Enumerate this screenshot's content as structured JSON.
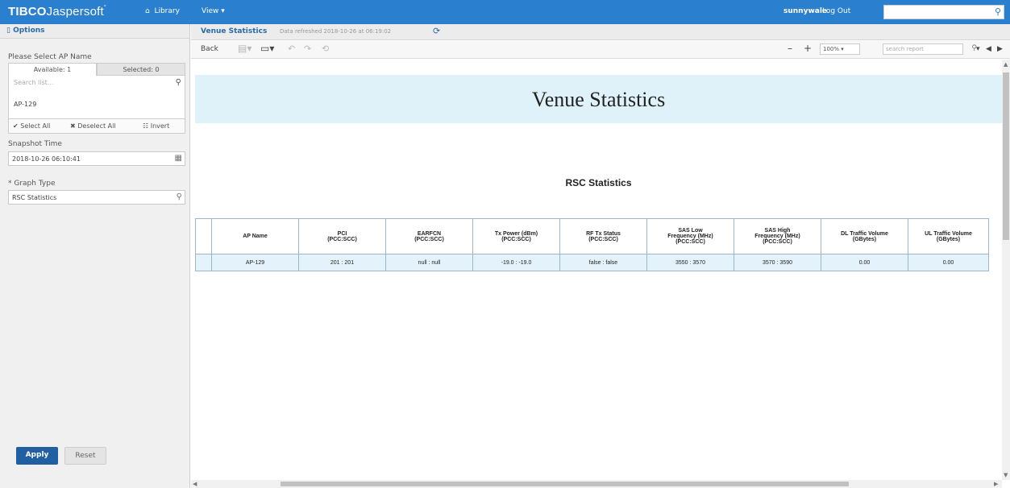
{
  "topbar": {
    "brand": "TIBCO",
    "product": "Jaspersoft",
    "home_icon": "home-icon",
    "library": "Library",
    "view_menu": "View ▾",
    "username": "sunnywale",
    "logout": "Log Out",
    "search_value": "",
    "bar_color": "#2a7fcf"
  },
  "options_panel": {
    "header": "Options",
    "ap_label": "Please Select AP Name",
    "tab_available": "Available: 1",
    "tab_selected": "Selected: 0",
    "list_search_placeholder": "Search list...",
    "list_items": [
      "AP-129"
    ],
    "select_all": "✔ Select All",
    "deselect_all": "✖ Deselect All",
    "invert": "☷ Invert",
    "snapshot_label": "Snapshot Time",
    "snapshot_value": "2018-10-26 06:10:41",
    "graph_type_label": "* Graph Type",
    "graph_type_value": "RSC Statistics",
    "apply": "Apply",
    "reset": "Reset",
    "apply_color": "#1f5fa2"
  },
  "report": {
    "title": "Venue Statistics",
    "refreshed": "Data refreshed 2018-10-26 at 06:19:02",
    "back": "Back",
    "zoom": "100%",
    "search_placeholder": "search report",
    "banner_title": "Venue Statistics",
    "subtitle": "RSC Statistics",
    "banner_color": "#dff1f9",
    "table_headers": [
      "AP Name",
      "PCI\n(PCC:SCC)",
      "EARFCN\n(PCC:SCC)",
      "Tx Power (dBm)\n(PCC:SCC)",
      "RF Tx Status\n(PCC:SCC)",
      "SAS Low\nFrequency (MHz)\n(PCC:SCC)",
      "SAS High\nFrequency (MHz)\n(PCC:SCC)",
      "DL Traffic Volume\n(GBytes)",
      "UL Traffic Volume\n(GBytes)"
    ],
    "table_rows": [
      [
        "AP-129",
        "201 : 201",
        "null : null",
        "-19.0 : -19.0",
        "false : false",
        "3550 : 3570",
        "3570 : 3590",
        "0.00",
        "0.00"
      ]
    ]
  }
}
